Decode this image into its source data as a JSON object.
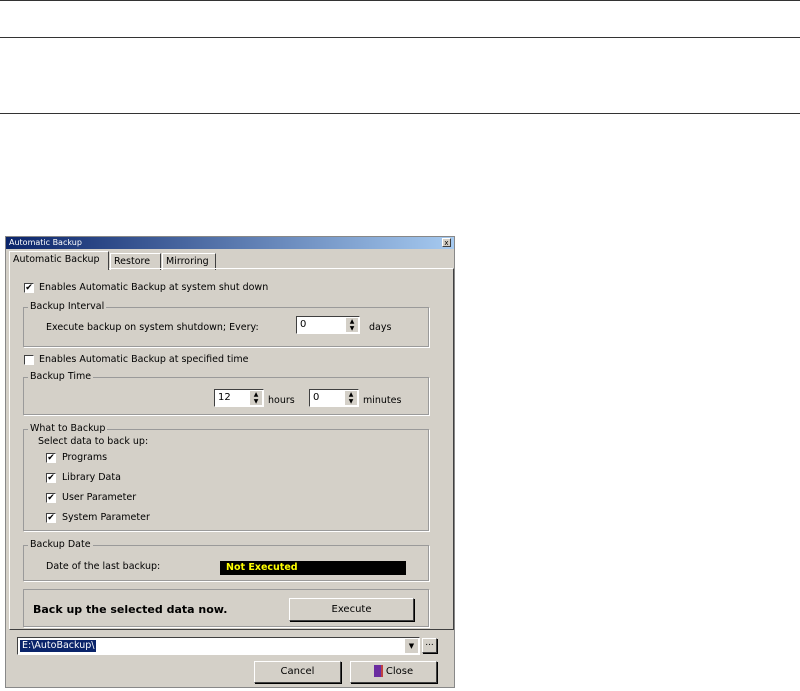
{
  "window": {
    "title": "Automatic Backup",
    "close_glyph": "x"
  },
  "tabs": [
    {
      "label": "Automatic Backup",
      "active": true
    },
    {
      "label": "Restore",
      "active": false
    },
    {
      "label": "Mirroring",
      "active": false
    }
  ],
  "shutdown_backup": {
    "enable_label": "Enables Automatic Backup at system shut down",
    "enabled": true,
    "group_label": "Backup Interval",
    "interval_label": "Execute backup on system shutdown; Every:",
    "interval_value": "0",
    "interval_unit": "days"
  },
  "timed_backup": {
    "enable_label": "Enables Automatic Backup at specified time",
    "enabled": false,
    "group_label": "Backup Time",
    "hours_value": "12",
    "hours_unit": "hours",
    "minutes_value": "0",
    "minutes_unit": "minutes"
  },
  "what_to_backup": {
    "group_label": "What to Backup",
    "instruction": "Select data to back up:",
    "items": [
      {
        "label": "Programs",
        "checked": true
      },
      {
        "label": "Library Data",
        "checked": true
      },
      {
        "label": "User Parameter",
        "checked": true
      },
      {
        "label": "System Parameter",
        "checked": true
      }
    ]
  },
  "backup_date": {
    "group_label": "Backup Date",
    "last_label": "Date of the last backup:",
    "last_value": "Not Executed"
  },
  "execute": {
    "message": "Back up the selected data now.",
    "button_label": "Execute"
  },
  "path": {
    "value": "E:\\AutoBackup\\",
    "browse_label": "..."
  },
  "footer": {
    "cancel_label": "Cancel",
    "close_label": "Close"
  },
  "colors": {
    "title_bar": "#0a246a",
    "dialog_bg": "#d4d0c8",
    "status_text": "#ffff00",
    "status_bg": "#000000"
  }
}
